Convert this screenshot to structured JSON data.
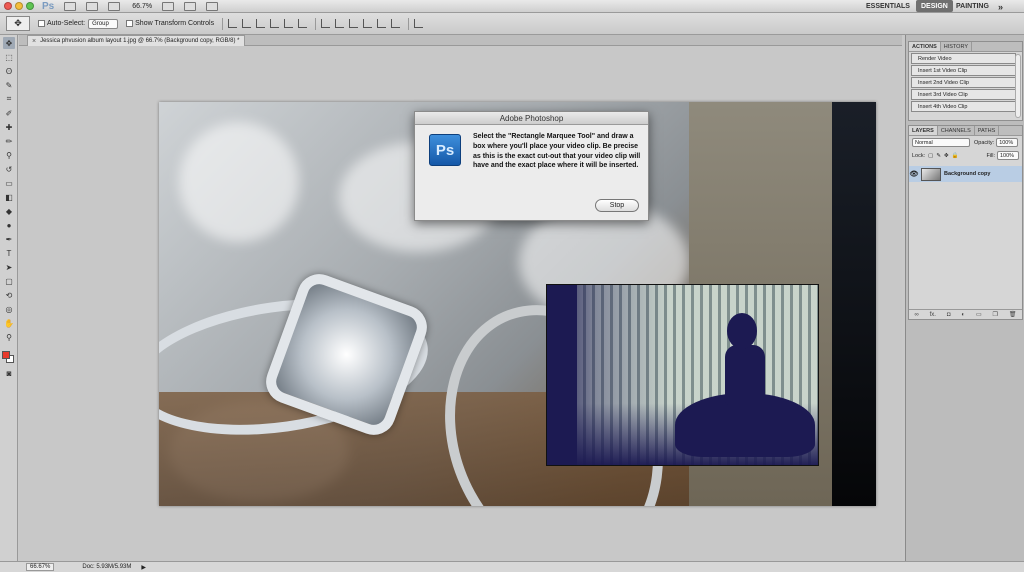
{
  "appbar": {
    "ps_logo": "Ps",
    "zoom": "66.7%",
    "workspaces": {
      "essentials": "ESSENTIALS",
      "design": "DESIGN",
      "painting": "PAINTING",
      "more": "»"
    }
  },
  "options": {
    "auto_select_label": "Auto-Select:",
    "auto_select_value": "Group",
    "show_transform_label": "Show Transform Controls"
  },
  "document": {
    "tab_title": "Jessica phvusion album layout 1.jpg @ 66.7% (Background copy, RGB/8) *",
    "close_glyph": "×"
  },
  "dialog": {
    "title": "Adobe Photoshop",
    "icon_text": "Ps",
    "message": "Select the \"Rectangle Marquee Tool\" and draw a box where you'll place your video clip. Be precise as this is the exact cut-out that your video clip will have and the exact place where it will be inserted.",
    "stop_label": "Stop"
  },
  "actions_panel": {
    "tabs": [
      "ACTIONS",
      "HISTORY"
    ],
    "items": [
      "Render Video",
      "Insert 1st Video Clip",
      "Insert 2nd Video Clip",
      "Insert 3rd Video Clip",
      "Insert 4th Video Clip"
    ]
  },
  "layers_panel": {
    "tabs": [
      "LAYERS",
      "CHANNELS",
      "PATHS"
    ],
    "blend_mode": "Normal",
    "opacity_label": "Opacity:",
    "opacity_value": "100%",
    "lock_label": "Lock:",
    "fill_label": "Fill:",
    "fill_value": "100%",
    "layer_name": "Background copy",
    "footer_fx": "fx."
  },
  "status": {
    "zoom": "66.67%",
    "doc": "Doc: 5.93M/5.93M",
    "arrow": "▶"
  },
  "colors": {
    "foreground": "#e8392a",
    "background": "#ffffff",
    "accent": "#b9cde4"
  }
}
